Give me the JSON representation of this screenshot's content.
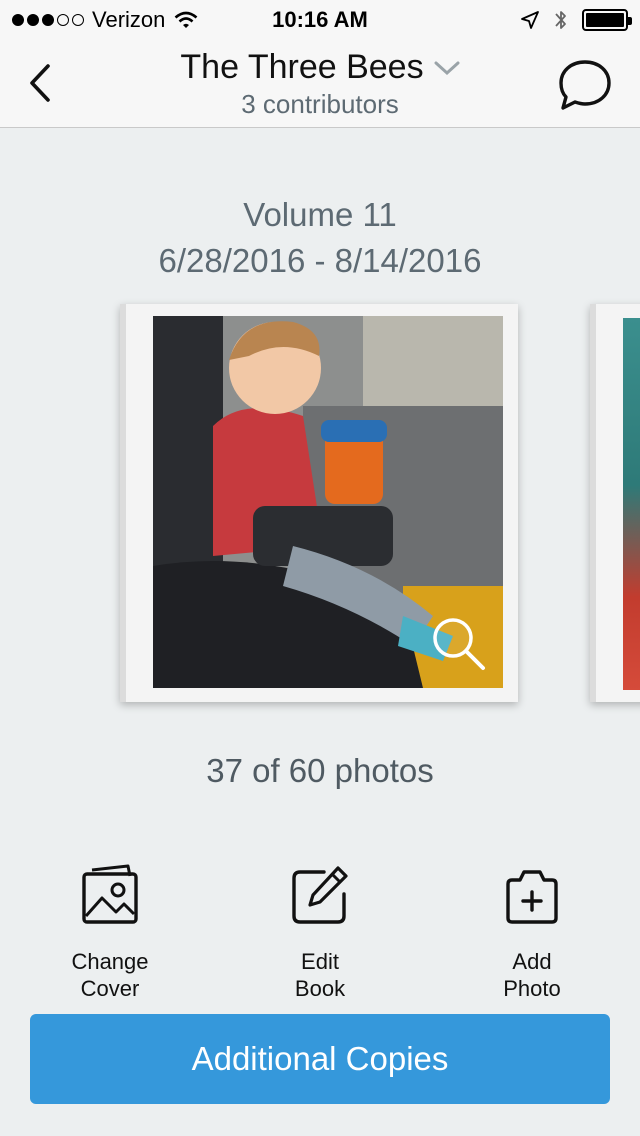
{
  "status_bar": {
    "carrier": "Verizon",
    "time": "10:16 AM",
    "signal_strength_bars": 3,
    "signal_total_bars": 5
  },
  "nav": {
    "title": "The Three Bees",
    "subtitle": "3 contributors",
    "back_icon": "chevron-left-icon",
    "chat_icon": "speech-bubble-icon",
    "dropdown_icon": "chevron-down-icon"
  },
  "volume": {
    "title": "Volume 11",
    "dates": "6/28/2016 - 8/14/2016"
  },
  "book": {
    "photo_count": "37 of 60 photos"
  },
  "actions": [
    {
      "line1": "Change",
      "line2": "Cover",
      "icon": "picture-icon"
    },
    {
      "line1": "Edit",
      "line2": "Book",
      "icon": "pencil-square-icon"
    },
    {
      "line1": "Add",
      "line2": "Photo",
      "icon": "camera-plus-icon"
    }
  ],
  "primary_button": {
    "label": "Additional Copies"
  },
  "colors": {
    "accent": "#3598db",
    "background": "#eceff0",
    "muted_text": "#5d6a73"
  }
}
